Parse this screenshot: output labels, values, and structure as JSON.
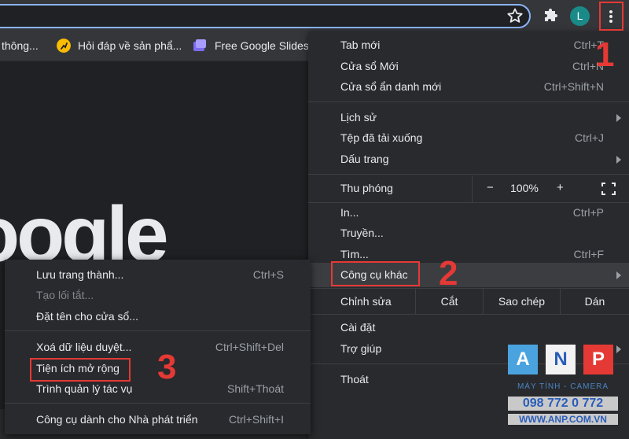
{
  "toolbar": {
    "avatar_letter": "L"
  },
  "bookmarks": [
    {
      "label": "thông..."
    },
    {
      "label": "Hỏi đáp về sản phẩ..."
    },
    {
      "label": "Free Google Slides..."
    }
  ],
  "page": {
    "logo_fragment": "oogle"
  },
  "main_menu": {
    "new_tab": {
      "label": "Tab mới",
      "shortcut": "Ctrl+T"
    },
    "new_window": {
      "label": "Cửa sổ Mới",
      "shortcut": "Ctrl+N"
    },
    "incognito": {
      "label": "Cửa sổ ẩn danh mới",
      "shortcut": "Ctrl+Shift+N"
    },
    "history": {
      "label": "Lịch sử"
    },
    "downloads": {
      "label": "Tệp đã tải xuống",
      "shortcut": "Ctrl+J"
    },
    "bookmarks": {
      "label": "Dấu trang"
    },
    "zoom": {
      "label": "Thu phóng",
      "minus": "−",
      "value": "100%",
      "plus": "+"
    },
    "print": {
      "label": "In...",
      "shortcut": "Ctrl+P"
    },
    "cast": {
      "label": "Truyền..."
    },
    "find": {
      "label": "Tìm...",
      "shortcut": "Ctrl+F"
    },
    "more_tools": {
      "label": "Công cụ khác"
    },
    "edit": {
      "label": "Chỉnh sửa",
      "cut": "Cắt",
      "copy": "Sao chép",
      "paste": "Dán"
    },
    "settings": {
      "label": "Cài đặt"
    },
    "help": {
      "label": "Trợ giúp"
    },
    "exit": {
      "label": "Thoát"
    }
  },
  "sub_menu": {
    "save_page": {
      "label": "Lưu trang thành...",
      "shortcut": "Ctrl+S"
    },
    "create_shortcut": {
      "label": "Tạo lối tắt..."
    },
    "name_window": {
      "label": "Đặt tên cho cửa sổ..."
    },
    "clear_data": {
      "label": "Xoá dữ liệu duyệt...",
      "shortcut": "Ctrl+Shift+Del"
    },
    "extensions": {
      "label": "Tiện ích mở rộng"
    },
    "task_manager": {
      "label": "Trình quản lý tác vụ",
      "shortcut": "Shift+Thoát"
    },
    "dev_tools": {
      "label": "Công cụ dành cho Nhà phát triển",
      "shortcut": "Ctrl+Shift+I"
    }
  },
  "annotations": {
    "step1": "1",
    "step2": "2",
    "step3": "3"
  },
  "watermark": {
    "letters": [
      "A",
      "N",
      "P"
    ],
    "tagline": "MÁY TÍNH - CAMERA",
    "phone": "098 772 0 772",
    "site": "WWW.ANP.COM.VN"
  },
  "colors": {
    "accent_red": "#e53935",
    "menu_bg": "#292a2d",
    "toolbar_bg": "#35363a"
  }
}
